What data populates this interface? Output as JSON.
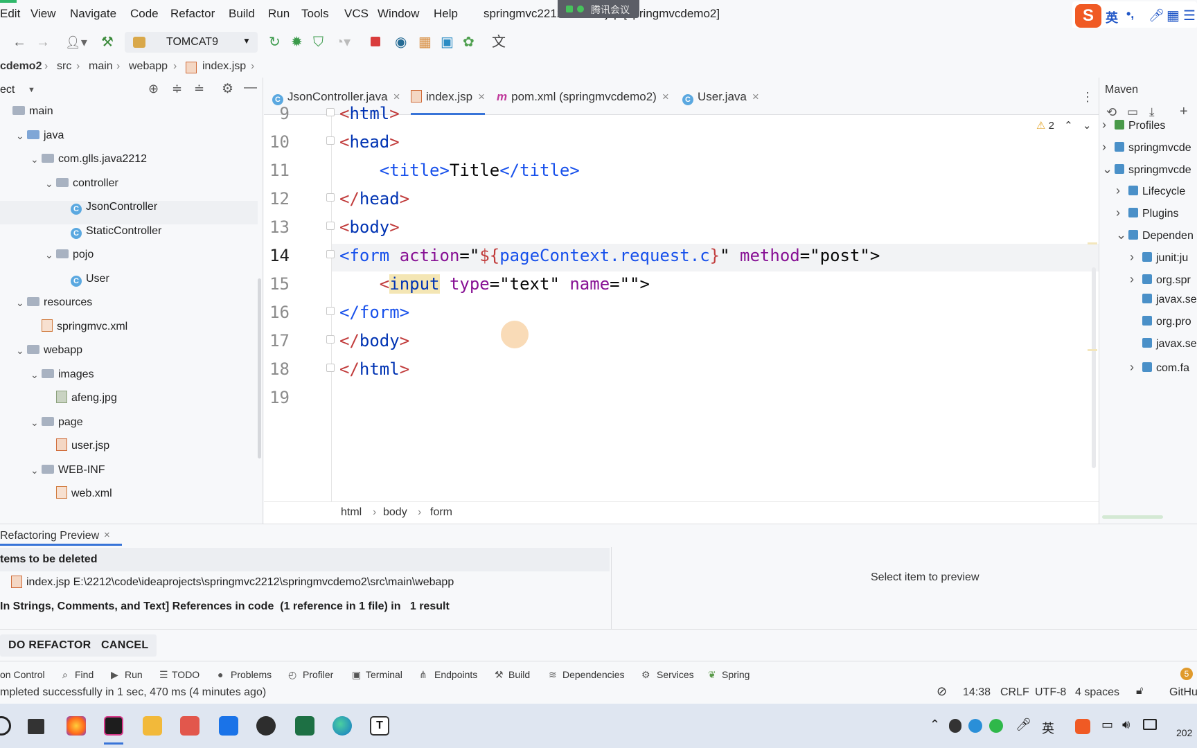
{
  "menubar": {
    "items": [
      "Edit",
      "View",
      "Navigate",
      "Code",
      "Refactor",
      "Build",
      "Run",
      "Tools",
      "VCS",
      "Window",
      "Help"
    ],
    "title": "springmvc2212 - index.jsp [springmvcdemo2]",
    "meeting": "腾讯会议"
  },
  "ime": {
    "lang": "英",
    "punct": "•,"
  },
  "toolbar": {
    "run_config": "TOMCAT9"
  },
  "breadcrumb": [
    "cdemo2",
    "src",
    "main",
    "webapp",
    "index.jsp"
  ],
  "project": {
    "header": "ect",
    "tree": [
      {
        "label": "main",
        "indent": 0,
        "chev": "",
        "icon": "folder"
      },
      {
        "label": "java",
        "indent": 1,
        "chev": "v",
        "icon": "folder-blue"
      },
      {
        "label": "com.glls.java2212",
        "indent": 2,
        "chev": "v",
        "icon": "folder"
      },
      {
        "label": "controller",
        "indent": 3,
        "chev": "v",
        "icon": "folder"
      },
      {
        "label": "JsonController",
        "indent": 4,
        "chev": "",
        "icon": "class",
        "selected": true
      },
      {
        "label": "StaticController",
        "indent": 4,
        "chev": "",
        "icon": "class"
      },
      {
        "label": "pojo",
        "indent": 3,
        "chev": "v",
        "icon": "folder"
      },
      {
        "label": "User",
        "indent": 4,
        "chev": "",
        "icon": "class"
      },
      {
        "label": "resources",
        "indent": 1,
        "chev": "v",
        "icon": "folder"
      },
      {
        "label": "springmvc.xml",
        "indent": 2,
        "chev": "",
        "icon": "xml"
      },
      {
        "label": "webapp",
        "indent": 1,
        "chev": "v",
        "icon": "folder"
      },
      {
        "label": "images",
        "indent": 2,
        "chev": "v",
        "icon": "folder"
      },
      {
        "label": "afeng.jpg",
        "indent": 3,
        "chev": "",
        "icon": "file"
      },
      {
        "label": "page",
        "indent": 2,
        "chev": "v",
        "icon": "folder"
      },
      {
        "label": "user.jsp",
        "indent": 3,
        "chev": "",
        "icon": "jsp"
      },
      {
        "label": "WEB-INF",
        "indent": 2,
        "chev": "v",
        "icon": "folder"
      },
      {
        "label": "web.xml",
        "indent": 3,
        "chev": "",
        "icon": "xml"
      }
    ]
  },
  "tabs": [
    {
      "label": "JsonController.java",
      "icon": "C"
    },
    {
      "label": "index.jsp",
      "icon": "JSP",
      "active": true
    },
    {
      "label": "pom.xml (springmvcdemo2)",
      "icon": "m"
    },
    {
      "label": "User.java",
      "icon": "C"
    }
  ],
  "editor": {
    "warnings": "2",
    "line_numbers": [
      "9",
      "10",
      "11",
      "12",
      "13",
      "14",
      "15",
      "16",
      "17",
      "18",
      "19"
    ],
    "lines": [
      [
        [
          "bracket",
          "<"
        ],
        [
          "tag",
          "html"
        ],
        [
          "bracket",
          ">"
        ]
      ],
      [
        [
          "bracket",
          "<"
        ],
        [
          "tag",
          "head"
        ],
        [
          "bracket",
          ">"
        ]
      ],
      [
        [
          "plain",
          "    "
        ],
        [
          "el",
          "<title>"
        ],
        [
          "plain",
          "Title"
        ],
        [
          "el",
          "</title>"
        ]
      ],
      [
        [
          "bracket",
          "</"
        ],
        [
          "tag",
          "head"
        ],
        [
          "bracket",
          ">"
        ]
      ],
      [
        [
          "bracket",
          "<"
        ],
        [
          "tag",
          "body"
        ],
        [
          "bracket",
          ">"
        ]
      ],
      [
        [
          "el",
          "<form "
        ],
        [
          "attr",
          "action"
        ],
        [
          "plain",
          "=\""
        ],
        [
          "bracket",
          "${"
        ],
        [
          "el",
          "pageContext.request.c"
        ],
        [
          "bracket",
          "}"
        ],
        [
          "plain",
          "\" "
        ],
        [
          "attr",
          "method"
        ],
        [
          "plain",
          "=\"post\">"
        ]
      ],
      [
        [
          "plain",
          "    "
        ],
        [
          "bracket",
          "<"
        ],
        [
          "tag",
          "input"
        ],
        [
          "plain",
          " "
        ],
        [
          "attr",
          "type"
        ],
        [
          "plain",
          "=\"text\" "
        ],
        [
          "attr",
          "name"
        ],
        [
          "plain",
          "=\"\">"
        ]
      ],
      [
        [
          "el",
          "</form>"
        ]
      ],
      [
        [
          "bracket",
          "</"
        ],
        [
          "tag",
          "body"
        ],
        [
          "bracket",
          ">"
        ]
      ],
      [
        [
          "bracket",
          "</"
        ],
        [
          "tag",
          "html"
        ],
        [
          "bracket",
          ">"
        ]
      ],
      []
    ],
    "breadcrumb": [
      "html",
      "body",
      "form"
    ]
  },
  "maven": {
    "title": "Maven",
    "items": [
      {
        "label": "Profiles",
        "chev": ">",
        "indent": 0
      },
      {
        "label": "springmvcde",
        "chev": ">",
        "indent": 0
      },
      {
        "label": "springmvcde",
        "chev": "v",
        "indent": 0
      },
      {
        "label": "Lifecycle",
        "chev": ">",
        "indent": 1
      },
      {
        "label": "Plugins",
        "chev": ">",
        "indent": 1
      },
      {
        "label": "Dependen",
        "chev": "v",
        "indent": 1
      },
      {
        "label": "junit:ju",
        "chev": ">",
        "indent": 2
      },
      {
        "label": "org.spr",
        "chev": ">",
        "indent": 2
      },
      {
        "label": "javax.se",
        "chev": "",
        "indent": 2
      },
      {
        "label": "org.pro",
        "chev": "",
        "indent": 2
      },
      {
        "label": "javax.se",
        "chev": "",
        "indent": 2
      },
      {
        "label": "com.fa",
        "chev": ">",
        "indent": 2
      }
    ]
  },
  "refactor": {
    "tab_label": "Refactoring Preview",
    "section": "tems to be deleted",
    "file_entry": "index.jsp E:\\2212\\code\\ideaprojects\\springmvc2212\\springmvcdemo2\\src\\main\\webapp",
    "references": "In Strings, Comments, and Text] References in code  (1 reference in 1 file) in   1 result",
    "preview_hint": "Select item to preview",
    "do_refactor": "DO REFACTOR",
    "cancel": "CANCEL"
  },
  "toolwindows": [
    "on Control",
    "Find",
    "Run",
    "TODO",
    "Problems",
    "Profiler",
    "Terminal",
    "Endpoints",
    "Build",
    "Dependencies",
    "Services",
    "Spring"
  ],
  "status": {
    "message": "mpleted successfully in 1 sec, 470 ms (4 minutes ago)",
    "position": "14:38",
    "line_sep": "CRLF",
    "encoding": "UTF-8",
    "indent": "4 spaces",
    "vcs": "GitHu"
  },
  "taskbar": {
    "clock": "202",
    "ime": "英"
  }
}
